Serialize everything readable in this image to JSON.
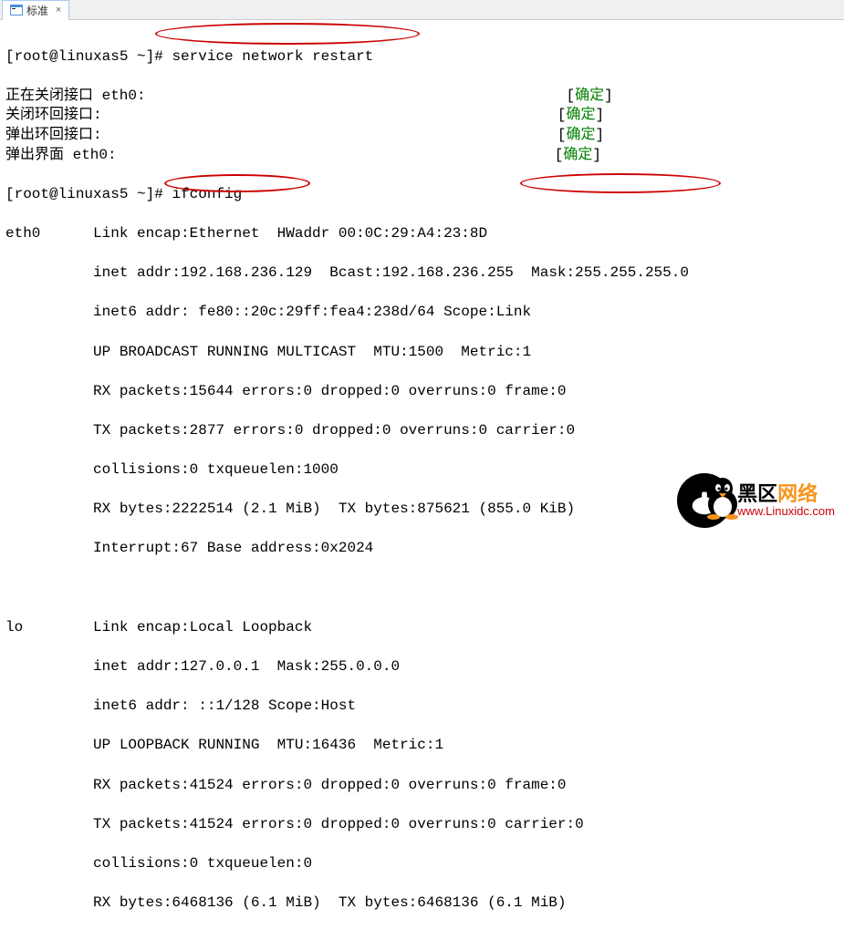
{
  "tab": {
    "label": "标准",
    "close": "×"
  },
  "prompt1": "[root@linuxas5 ~]# ",
  "cmd1": "service network restart",
  "output_restart": [
    {
      "text": "正在关闭接口 eth0:",
      "pad": 48,
      "status": "确定"
    },
    {
      "text": "关闭环回接口:",
      "pad": 52,
      "status": "确定"
    },
    {
      "text": "弹出环回接口:",
      "pad": 52,
      "status": "确定"
    },
    {
      "text": "弹出界面 eth0:",
      "pad": 50,
      "status": "确定"
    }
  ],
  "prompt2": "[root@linuxas5 ~]# ",
  "cmd2": "ifconfig",
  "eth0": {
    "name": "eth0",
    "l1": "Link encap:Ethernet  HWaddr 00:0C:29:A4:23:8D",
    "inet_label": "inet addr:",
    "inet_addr": "192.168.236.129",
    "bcast_label": "  Bcast:",
    "bcast": "192.168.236.255",
    "mask_label": "  Mask:",
    "mask": "255.255.255.0",
    "l3": "inet6 addr: fe80::20c:29ff:fea4:238d/64 Scope:Link",
    "l4": "UP BROADCAST RUNNING MULTICAST  MTU:1500  Metric:1",
    "l5": "RX packets:15644 errors:0 dropped:0 overruns:0 frame:0",
    "l6": "TX packets:2877 errors:0 dropped:0 overruns:0 carrier:0",
    "l7": "collisions:0 txqueuelen:1000",
    "l8": "RX bytes:2222514 (2.1 MiB)  TX bytes:875621 (855.0 KiB)",
    "l9": "Interrupt:67 Base address:0x2024"
  },
  "lo": {
    "name": "lo",
    "l1": "Link encap:Local Loopback",
    "l2": "inet addr:127.0.0.1  Mask:255.0.0.0",
    "l3": "inet6 addr: ::1/128 Scope:Host",
    "l4": "UP LOOPBACK RUNNING  MTU:16436  Metric:1",
    "l5": "RX packets:41524 errors:0 dropped:0 overruns:0 frame:0",
    "l6": "TX packets:41524 errors:0 dropped:0 overruns:0 carrier:0",
    "l7": "collisions:0 txqueuelen:0",
    "l8": "RX bytes:6468136 (6.1 MiB)  TX bytes:6468136 (6.1 MiB)"
  },
  "status_bracket_l": "[",
  "status_bracket_r": "]",
  "watermark": {
    "cn1": "黑区",
    "cn2": "网络",
    "en": "www.Linuxidc.com"
  },
  "spacing": {
    "iface_col": "          ",
    "iface_indent": "          "
  }
}
